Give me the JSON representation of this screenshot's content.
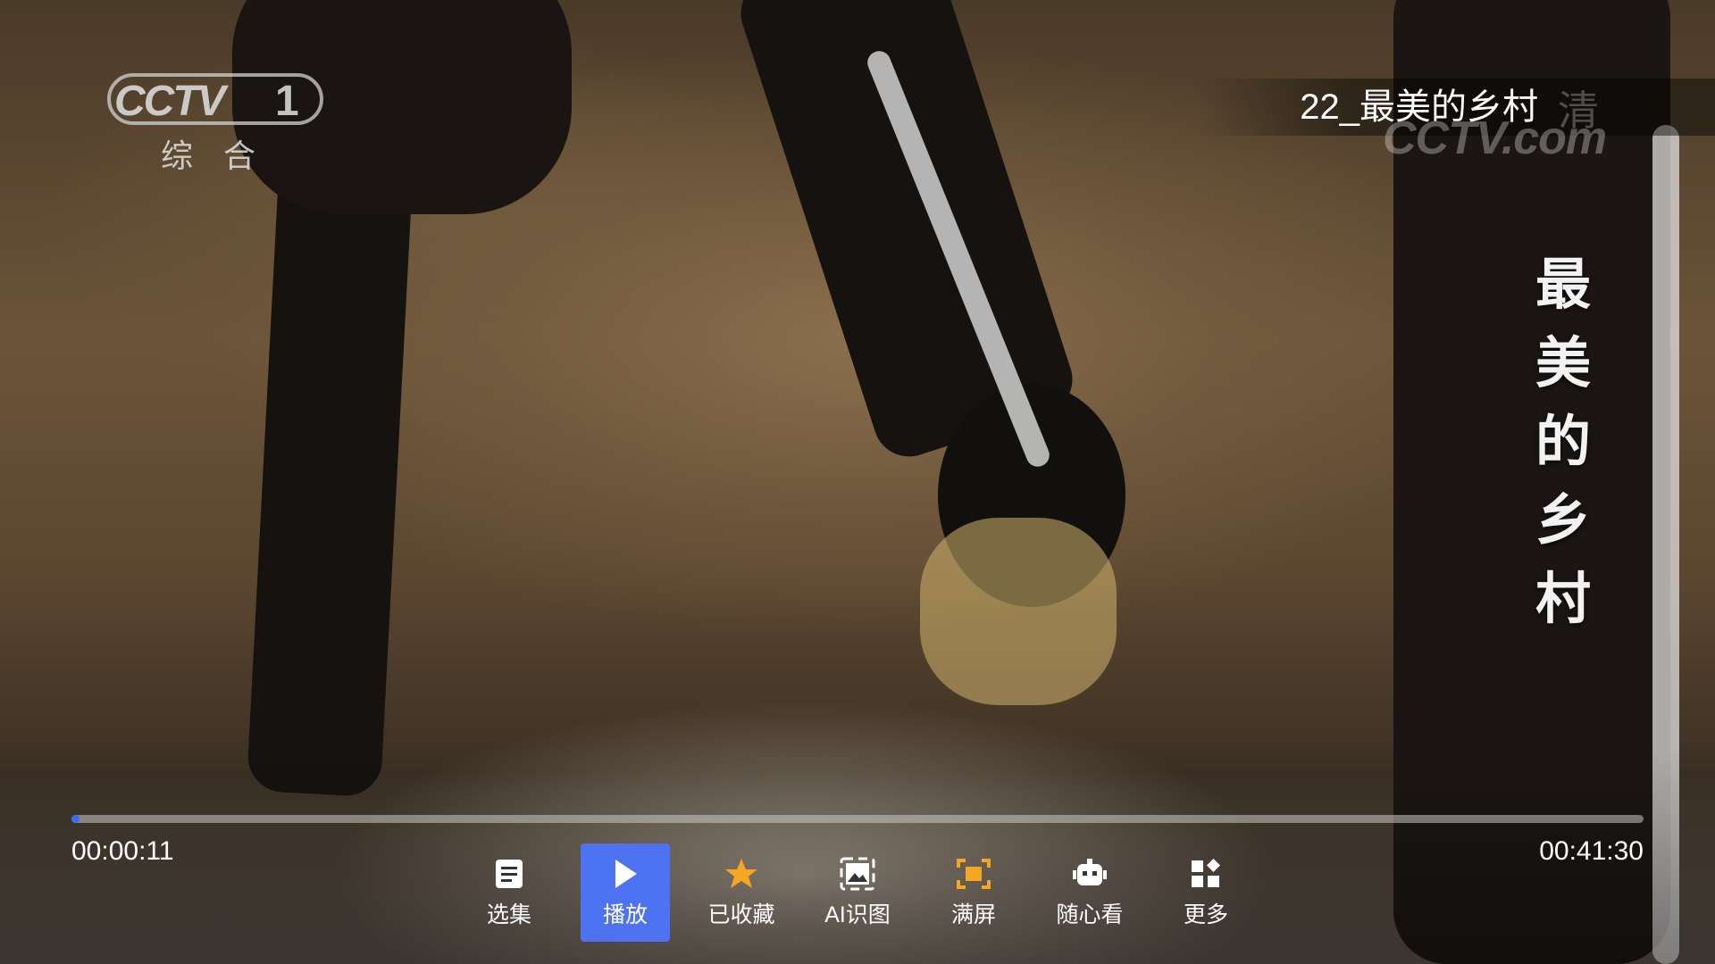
{
  "channel_logo": {
    "brand": "CCTV",
    "number": "1",
    "subtitle": "综合"
  },
  "episode": {
    "title": "22_最美的乡村"
  },
  "watermark": {
    "text": "CCTV.com",
    "quality": "清"
  },
  "video_overlay_title": [
    "最",
    "美",
    "的",
    "乡",
    "村"
  ],
  "playback": {
    "current_time": "00:00:11",
    "total_time": "00:41:30",
    "progress_fraction": 0.0044
  },
  "menu": {
    "items": [
      {
        "key": "episodes",
        "label": "选集",
        "icon": "list-icon",
        "active": false
      },
      {
        "key": "play",
        "label": "播放",
        "icon": "play-icon",
        "active": true
      },
      {
        "key": "favorite",
        "label": "已收藏",
        "icon": "star-icon",
        "active": false
      },
      {
        "key": "ai",
        "label": "AI识图",
        "icon": "image-icon",
        "active": false
      },
      {
        "key": "fullscreen",
        "label": "满屏",
        "icon": "fullscreen-icon",
        "active": false
      },
      {
        "key": "random",
        "label": "随心看",
        "icon": "robot-icon",
        "active": false
      },
      {
        "key": "more",
        "label": "更多",
        "icon": "grid-icon",
        "active": false
      }
    ]
  },
  "colors": {
    "accent": "#4d72f2",
    "progress": "#3a6cf4",
    "star": "#f5a623",
    "fullscreen": "#f5a623"
  }
}
